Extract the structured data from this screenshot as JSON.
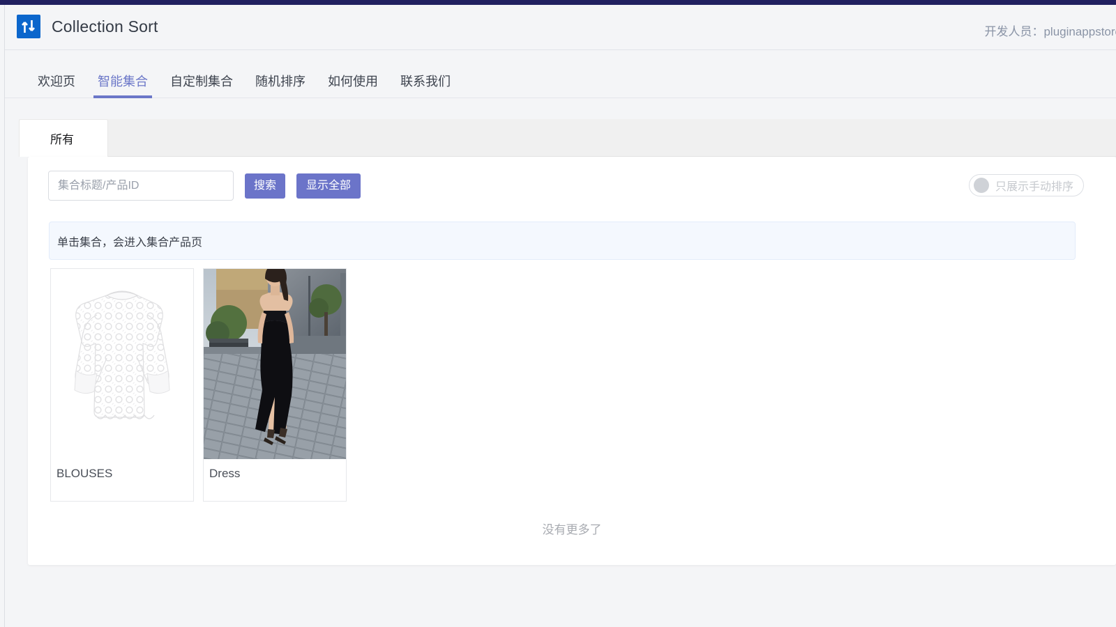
{
  "window": {
    "accent_navy": "#212060",
    "accent_purple": "#6b74c9",
    "page_bg": "#f4f5f7"
  },
  "header": {
    "logo_icon": "sort-arrows-icon",
    "app_title": "Collection Sort",
    "developer_text": "开发人员：pluginappstore"
  },
  "main_nav": {
    "items": [
      {
        "label": "欢迎页",
        "active": false
      },
      {
        "label": "智能集合",
        "active": true
      },
      {
        "label": "自定制集合",
        "active": false
      },
      {
        "label": "随机排序",
        "active": false
      },
      {
        "label": "如何使用",
        "active": false
      },
      {
        "label": "联系我们",
        "active": false
      }
    ]
  },
  "tab_strip": {
    "tabs": [
      {
        "label": "所有",
        "active": true
      }
    ]
  },
  "toolbar": {
    "search_placeholder": "集合标题/产品ID",
    "search_value": "",
    "search_button": "搜索",
    "show_all_button": "显示全部",
    "toggle_label": "只展示手动排序",
    "toggle_state": "off"
  },
  "banner": {
    "text": "单击集合，会进入集合产品页"
  },
  "collections": [
    {
      "name": "BLOUSES",
      "image": "white-lace-blouse-photo"
    },
    {
      "name": "Dress",
      "image": "black-slit-dress-photo"
    }
  ],
  "footer": {
    "end_of_list": "没有更多了"
  }
}
